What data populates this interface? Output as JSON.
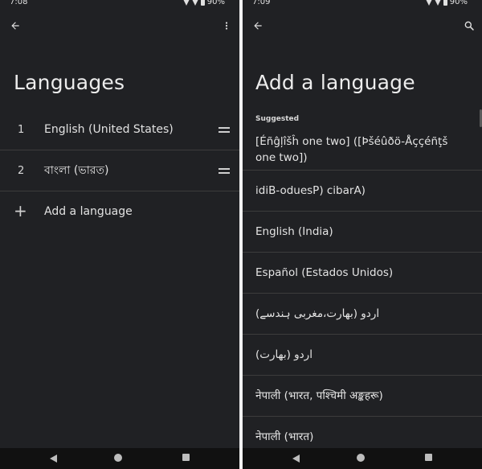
{
  "left": {
    "status": {
      "time": "7:08",
      "battery": "90%"
    },
    "title": "Languages",
    "languages": [
      {
        "num": "1",
        "label": "English (United States)"
      },
      {
        "num": "2",
        "label": "বাংলা (ভারত)"
      }
    ],
    "add_label": "Add a language",
    "icons": {
      "back": "arrow-back-icon",
      "overflow": "more-vert-icon",
      "drag": "drag-handle-icon",
      "plus": "plus-icon"
    }
  },
  "right": {
    "status": {
      "time": "7:09",
      "battery": "90%"
    },
    "title": "Add a language",
    "section_label": "Suggested",
    "items": [
      "[Éñĝļîšĥ one two] ([Þšéûðö-Åççéñţš one two])",
      "idiB-oduesP) cibarA)",
      "English (India)",
      "Español (Estados Unidos)",
      "اردو (بھارت،مغربی ہندسے)",
      "اردو (بھارت)",
      "नेपाली (भारत, पश्चिमी अङ्कहरू)",
      "नेपाली (भारत)"
    ],
    "icons": {
      "back": "arrow-back-icon",
      "search": "search-icon"
    }
  },
  "colors": {
    "background": "#202124",
    "text": "#e8e8e8",
    "divider": "#3c3c3c"
  }
}
